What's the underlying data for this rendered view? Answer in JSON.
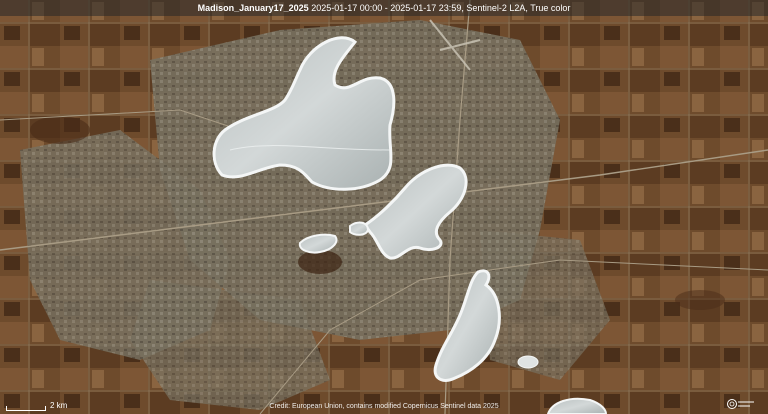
{
  "header": {
    "location": "Madison_January17_2025",
    "details": "2025-01-17 00:00 - 2025-01-17 23:59, Sentinel-2 L2A, True color"
  },
  "scale_bar": {
    "label": "2 km"
  },
  "footer": {
    "credit": "Credit: European Union, contains modified Copernicus Sentinel data 2025"
  },
  "colors": {
    "land": "#6e4b2c",
    "farm_light": "#8a6440",
    "farm_dark": "#4a2f1a",
    "urban": "#76705f",
    "ice": "#c9cfcf",
    "ice_edge": "#f4f6f6"
  },
  "icons": {
    "logo": "copernicus-logo"
  }
}
